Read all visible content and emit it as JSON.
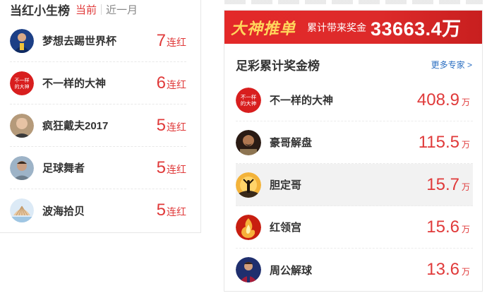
{
  "left": {
    "title": "当红小生榜",
    "tabs": [
      {
        "label": "当前"
      },
      {
        "label": "近一月"
      }
    ],
    "items": [
      {
        "name": "梦想去踢世界杯",
        "streak": "7",
        "unit": "连红"
      },
      {
        "name": "不一样的大神",
        "streak": "6",
        "unit": "连红"
      },
      {
        "name": "疯狂戴夫2017",
        "streak": "5",
        "unit": "连红"
      },
      {
        "name": "足球舞者",
        "streak": "5",
        "unit": "连红"
      },
      {
        "name": "波海拾贝",
        "streak": "5",
        "unit": "连红"
      }
    ],
    "avatar2_text": "不一样的大神"
  },
  "right": {
    "banner": {
      "logo": "大神推单",
      "label": "累计带来奖金",
      "amount": "33663.4万"
    },
    "title": "足彩累计奖金榜",
    "more": "更多专家 >",
    "items": [
      {
        "name": "不一样的大神",
        "value": "408.9",
        "unit": "万"
      },
      {
        "name": "豪哥解盘",
        "value": "115.5",
        "unit": "万"
      },
      {
        "name": "胆定哥",
        "value": "15.7",
        "unit": "万"
      },
      {
        "name": "红领宫",
        "value": "15.6",
        "unit": "万"
      },
      {
        "name": "周公解球",
        "value": "13.6",
        "unit": "万"
      }
    ],
    "avatar1_text": "不一样的大神"
  },
  "colors": {
    "accent": "#e03a3a",
    "banner": "#e32929",
    "link": "#2b6fc2"
  }
}
